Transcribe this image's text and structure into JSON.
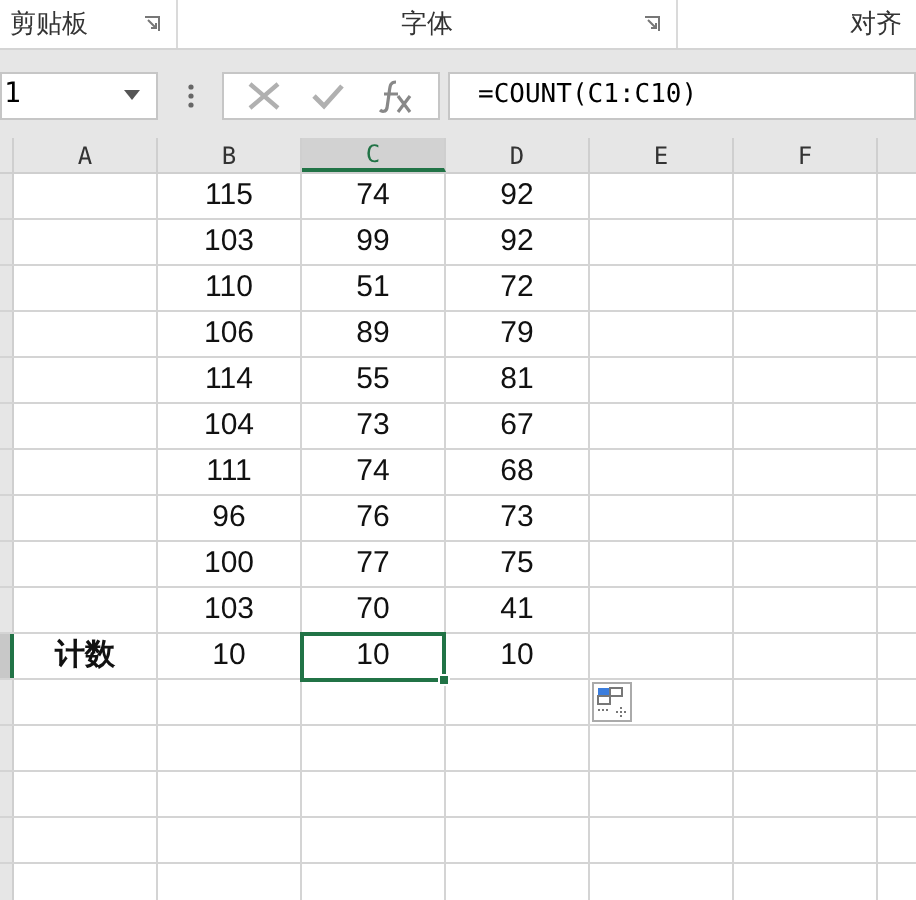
{
  "ribbon_groups": [
    {
      "label": "剪贴板",
      "launcher": true
    },
    {
      "label": "字体",
      "launcher": true
    },
    {
      "label": "对齐",
      "launcher": false
    }
  ],
  "name_box": {
    "value": "1"
  },
  "formula_bar": {
    "value": "=COUNT(C1:C10)"
  },
  "columns": [
    {
      "label": "A",
      "selected": false
    },
    {
      "label": "B",
      "selected": false
    },
    {
      "label": "C",
      "selected": true
    },
    {
      "label": "D",
      "selected": false
    },
    {
      "label": "E",
      "selected": false
    },
    {
      "label": "F",
      "selected": false
    }
  ],
  "rows": [
    {
      "selected": false,
      "values": [
        {
          "text": "115",
          "active": false
        },
        {
          "text": "74",
          "active": false
        },
        {
          "text": "92",
          "active": false
        }
      ]
    },
    {
      "selected": false,
      "values": [
        {
          "text": "103",
          "active": false
        },
        {
          "text": "99",
          "active": false
        },
        {
          "text": "92",
          "active": false
        }
      ]
    },
    {
      "selected": false,
      "values": [
        {
          "text": "110",
          "active": false
        },
        {
          "text": "51",
          "active": false
        },
        {
          "text": "72",
          "active": false
        }
      ]
    },
    {
      "selected": false,
      "values": [
        {
          "text": "106",
          "active": false
        },
        {
          "text": "89",
          "active": false
        },
        {
          "text": "79",
          "active": false
        }
      ]
    },
    {
      "selected": false,
      "values": [
        {
          "text": "114",
          "active": false
        },
        {
          "text": "55",
          "active": false
        },
        {
          "text": "81",
          "active": false
        }
      ]
    },
    {
      "selected": false,
      "values": [
        {
          "text": "104",
          "active": false
        },
        {
          "text": "73",
          "active": false
        },
        {
          "text": "67",
          "active": false
        }
      ]
    },
    {
      "selected": false,
      "values": [
        {
          "text": "111",
          "active": false
        },
        {
          "text": "74",
          "active": false
        },
        {
          "text": "68",
          "active": false
        }
      ]
    },
    {
      "selected": false,
      "values": [
        {
          "text": "96",
          "active": false
        },
        {
          "text": "76",
          "active": false
        },
        {
          "text": "73",
          "active": false
        }
      ]
    },
    {
      "selected": false,
      "values": [
        {
          "text": "100",
          "active": false
        },
        {
          "text": "77",
          "active": false
        },
        {
          "text": "75",
          "active": false
        }
      ]
    },
    {
      "selected": false,
      "values": [
        {
          "text": "103",
          "active": false
        },
        {
          "text": "70",
          "active": false
        },
        {
          "text": "41",
          "active": false
        }
      ]
    },
    {
      "selected": true,
      "label": "计数",
      "values": [
        {
          "text": "10",
          "active": false
        },
        {
          "text": "10",
          "active": true
        },
        {
          "text": "10",
          "active": false
        }
      ]
    }
  ]
}
